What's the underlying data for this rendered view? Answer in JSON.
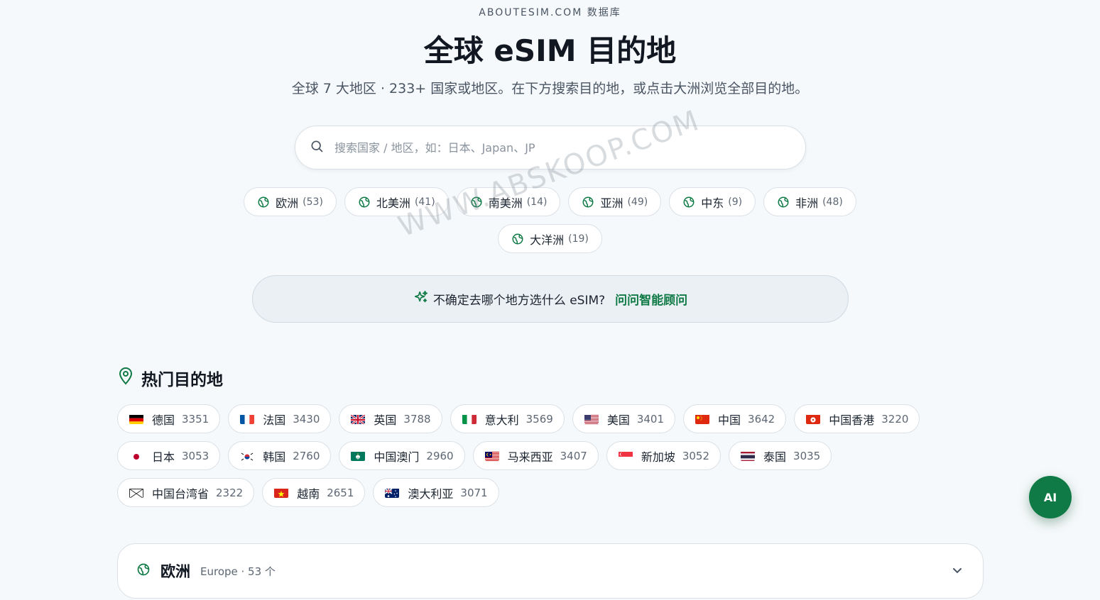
{
  "header": {
    "eyebrow": "ABOUTESIM.COM 数据库",
    "title": "全球 eSIM 目的地",
    "subtitle": "全球 7 大地区 · 233+ 国家或地区。在下方搜索目的地，或点击大洲浏览全部目的地。"
  },
  "search": {
    "placeholder": "搜索国家 / 地区，如：日本、Japan、JP",
    "value": ""
  },
  "continents": [
    {
      "label": "欧洲",
      "count": "(53)"
    },
    {
      "label": "北美洲",
      "count": "(41)"
    },
    {
      "label": "南美洲",
      "count": "(14)"
    },
    {
      "label": "亚洲",
      "count": "(49)"
    },
    {
      "label": "中东",
      "count": "(9)"
    },
    {
      "label": "非洲",
      "count": "(48)"
    },
    {
      "label": "大洋洲",
      "count": "(19)"
    }
  ],
  "ai_banner": {
    "text": "不确定去哪个地方选什么 eSIM?",
    "link": "问问智能顾问"
  },
  "popular": {
    "title": "热门目的地",
    "items": [
      {
        "name": "德国",
        "count": "3351",
        "flag": "de"
      },
      {
        "name": "法国",
        "count": "3430",
        "flag": "fr"
      },
      {
        "name": "英国",
        "count": "3788",
        "flag": "gb"
      },
      {
        "name": "意大利",
        "count": "3569",
        "flag": "it"
      },
      {
        "name": "美国",
        "count": "3401",
        "flag": "us"
      },
      {
        "name": "中国",
        "count": "3642",
        "flag": "cn"
      },
      {
        "name": "中国香港",
        "count": "3220",
        "flag": "hk"
      },
      {
        "name": "日本",
        "count": "3053",
        "flag": "jp"
      },
      {
        "name": "韩国",
        "count": "2760",
        "flag": "kr"
      },
      {
        "name": "中国澳门",
        "count": "2960",
        "flag": "mo"
      },
      {
        "name": "马来西亚",
        "count": "3407",
        "flag": "my"
      },
      {
        "name": "新加坡",
        "count": "3052",
        "flag": "sg"
      },
      {
        "name": "泰国",
        "count": "3035",
        "flag": "th"
      },
      {
        "name": "中国台湾省",
        "count": "2322",
        "flag": "placeholder"
      },
      {
        "name": "越南",
        "count": "2651",
        "flag": "vn"
      },
      {
        "name": "澳大利亚",
        "count": "3071",
        "flag": "au"
      }
    ]
  },
  "region_card": {
    "name": "欧洲",
    "meta": "Europe · 53 个"
  },
  "fab": {
    "label": "AI"
  },
  "watermark": "WWW.ABSKOOP.COM",
  "colors": {
    "accent": "#0f7a45",
    "background": "#f6f9fb"
  }
}
